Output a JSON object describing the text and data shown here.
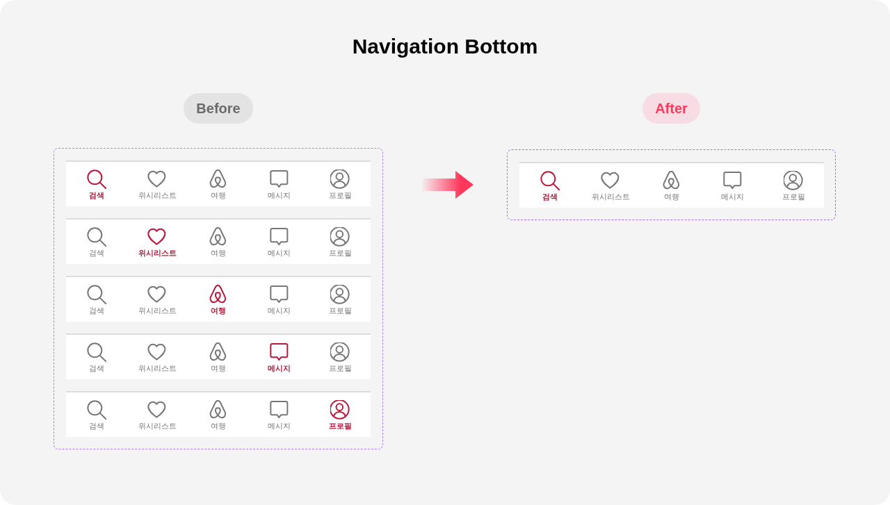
{
  "title": "Navigation Bottom",
  "before": {
    "label": "Before",
    "bars": [
      {
        "items": [
          {
            "label": "검색",
            "selected": true
          },
          {
            "label": "위시리스트",
            "selected": false
          },
          {
            "label": "여행",
            "selected": false
          },
          {
            "label": "메시지",
            "selected": false
          },
          {
            "label": "프로필",
            "selected": false
          }
        ]
      },
      {
        "items": [
          {
            "label": "검색",
            "selected": false
          },
          {
            "label": "위시리스트",
            "selected": true
          },
          {
            "label": "여행",
            "selected": false
          },
          {
            "label": "메시지",
            "selected": false
          },
          {
            "label": "프로필",
            "selected": false
          }
        ]
      },
      {
        "items": [
          {
            "label": "검색",
            "selected": false
          },
          {
            "label": "위시리스트",
            "selected": false
          },
          {
            "label": "여행",
            "selected": true
          },
          {
            "label": "메시지",
            "selected": false
          },
          {
            "label": "프로필",
            "selected": false
          }
        ]
      },
      {
        "items": [
          {
            "label": "검색",
            "selected": false
          },
          {
            "label": "위시리스트",
            "selected": false
          },
          {
            "label": "여행",
            "selected": false
          },
          {
            "label": "메시지",
            "selected": true
          },
          {
            "label": "프로필",
            "selected": false
          }
        ]
      },
      {
        "items": [
          {
            "label": "검색",
            "selected": false
          },
          {
            "label": "위시리스트",
            "selected": false
          },
          {
            "label": "여행",
            "selected": false
          },
          {
            "label": "메시지",
            "selected": false
          },
          {
            "label": "프로필",
            "selected": true
          }
        ]
      }
    ]
  },
  "after": {
    "label": "After",
    "bars": [
      {
        "items": [
          {
            "label": "검색",
            "selected": true
          },
          {
            "label": "위시리스트",
            "selected": false
          },
          {
            "label": "여행",
            "selected": false
          },
          {
            "label": "메시지",
            "selected": false
          },
          {
            "label": "프로필",
            "selected": false
          }
        ]
      }
    ]
  }
}
